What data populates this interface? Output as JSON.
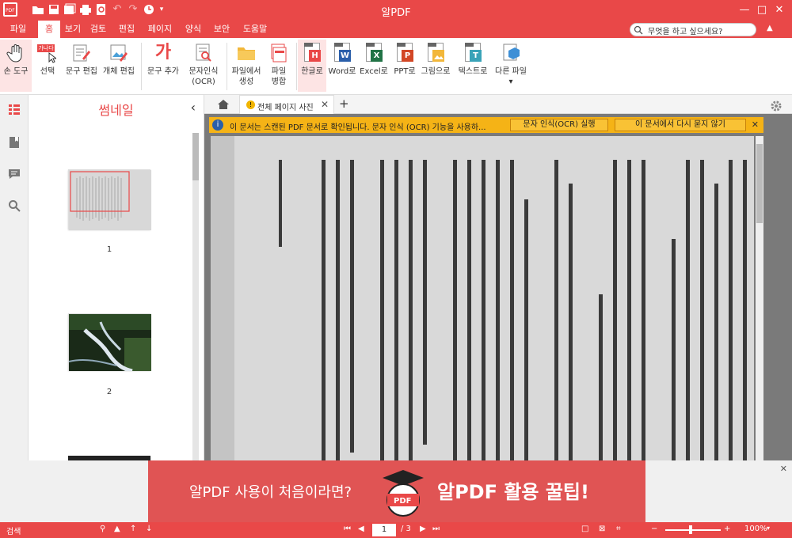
{
  "app": {
    "title": "알PDF"
  },
  "window": {
    "minimize": "—",
    "maximize": "□",
    "close": "✕"
  },
  "menu": {
    "tabs": [
      "파일",
      "홈",
      "보기",
      "검토",
      "편집",
      "페이지",
      "양식",
      "보안",
      "도움말"
    ],
    "active": "홈"
  },
  "search": {
    "placeholder": "무엇을 하고 싶으세요?"
  },
  "ribbon": {
    "hand_tool": "손 도구",
    "select": "선택",
    "select_badge": "가나다",
    "edit_text": "문구 편집",
    "edit_object": "개체 편집",
    "add_text": "문구 추가",
    "add_text_glyph": "가",
    "ocr_line1": "문자인식",
    "ocr_line2": "(OCR)",
    "from_file_1": "파일에서",
    "from_file_2": "생성",
    "merge_1": "파일",
    "merge_2": "병합",
    "to_hangul": "한글로",
    "to_word": "Word로",
    "to_excel": "Excel로",
    "to_ppt": "PPT로",
    "to_image": "그림으로",
    "to_text": "텍스트로",
    "to_other": "다른 파일",
    "badge_h": "H",
    "badge_w": "W",
    "badge_x": "X",
    "badge_p": "P",
    "badge_t": "T"
  },
  "thumbnails": {
    "title": "썸네일",
    "pages": [
      "1",
      "2"
    ]
  },
  "doc_tab": {
    "label": "전체 페이지 사진"
  },
  "ocr_notice": {
    "message": "이 문서는 스캔된 PDF 문서로 확인됩니다. 문자 인식 (OCR) 기능을 사용하...",
    "run_button": "문자 인식(OCR) 실행",
    "dont_ask_button": "이 문서에서 다시 묻지 않기"
  },
  "ad": {
    "left_text": "알PDF 사용이 처음이라면?",
    "right_text": "알PDF 활용 꿀팁!",
    "mascot_label": "PDF"
  },
  "status": {
    "search_label": "검색",
    "current_page": "1",
    "total_pages": "/ 3",
    "zoom": "100%"
  },
  "colors": {
    "brand": "#e94848",
    "notice": "#f5b316"
  }
}
